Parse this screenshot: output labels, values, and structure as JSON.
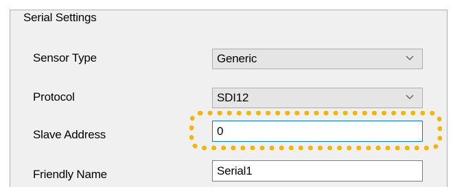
{
  "group": {
    "title": "Serial Settings"
  },
  "fields": {
    "sensor_type": {
      "label": "Sensor Type",
      "value": "Generic"
    },
    "protocol": {
      "label": "Protocol",
      "value": "SDI12"
    },
    "slave_address": {
      "label": "Slave Address",
      "value": "0"
    },
    "friendly_name": {
      "label": "Friendly Name",
      "value": "Serial1"
    }
  },
  "icons": {
    "dropdown": "chevron-down-icon"
  },
  "colors": {
    "panel_background": "#f0f0f0",
    "focus_border": "#0078d7",
    "highlight": "#f4b400"
  }
}
